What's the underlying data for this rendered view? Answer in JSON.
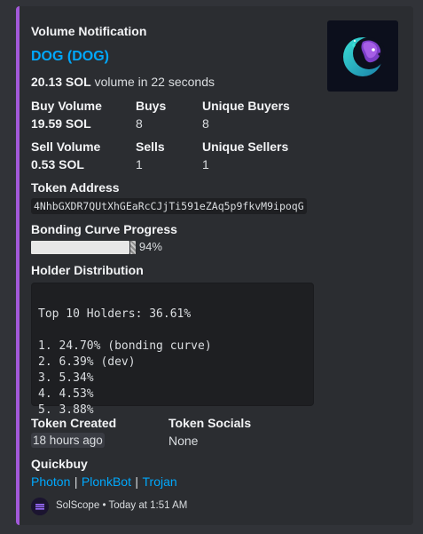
{
  "embed": {
    "header": "Volume Notification",
    "token_title": "DOG (DOG)",
    "volume_line": {
      "amount": "20.13 SOL",
      "suffix": "volume in 22 seconds"
    },
    "stats": {
      "buy_volume_label": "Buy Volume",
      "buy_volume_value": "19.59 SOL",
      "buys_label": "Buys",
      "buys_value": "8",
      "unique_buyers_label": "Unique Buyers",
      "unique_buyers_value": "8",
      "sell_volume_label": "Sell Volume",
      "sell_volume_value": "0.53 SOL",
      "sells_label": "Sells",
      "sells_value": "1",
      "unique_sellers_label": "Unique Sellers",
      "unique_sellers_value": "1"
    },
    "token_address_label": "Token Address",
    "token_address": "4NhbGXDR7QUtXhGEaRcCJjTi591eZAq5p9fkvM9ipoqG",
    "bonding_label": "Bonding Curve Progress",
    "bonding_percent_text": "94%",
    "bonding_fraction": 0.94,
    "holder_label": "Holder Distribution",
    "holder_lines": [
      "Top 10 Holders: 36.61%",
      "",
      "1. 24.70% (bonding curve)",
      "2. 6.39% (dev)",
      "3. 5.34%",
      "4. 4.53%",
      "5. 3.88%"
    ],
    "token_created_label": "Token Created",
    "token_created_value": "18 hours ago",
    "token_socials_label": "Token Socials",
    "token_socials_value": "None",
    "quickbuy_label": "Quickbuy",
    "quickbuy_links": [
      "Photon",
      "PlonkBot",
      "Trojan"
    ],
    "footer": {
      "author": "SolScope",
      "separator": "•",
      "time": "Today at 1:51 AM"
    },
    "colors": {
      "accent_bar": "#a259d9",
      "link": "#00a8fc"
    },
    "thumbnail_icon": "dog-moon-logo-icon"
  }
}
